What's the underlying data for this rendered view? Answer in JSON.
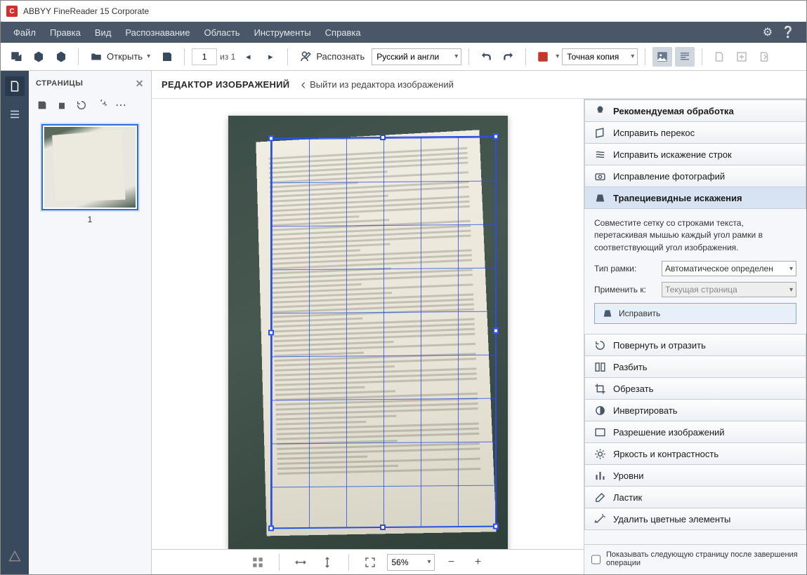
{
  "titlebar": {
    "title": "ABBYY FineReader 15 Corporate"
  },
  "menubar": {
    "items": [
      "Файл",
      "Правка",
      "Вид",
      "Распознавание",
      "Область",
      "Инструменты",
      "Справка"
    ]
  },
  "toolbar": {
    "open_label": "Открыть",
    "page_current": "1",
    "page_total_label": "из 1",
    "recognize_label": "Распознать",
    "lang_label": "Русский и англи",
    "mode_label": "Точная копия"
  },
  "pagespanel": {
    "title": "СТРАНИЦЫ",
    "thumb_label": "1"
  },
  "editorhdr": {
    "title": "РЕДАКТОР ИЗОБРАЖЕНИЙ",
    "back_label": "Выйти из редактора изображений"
  },
  "bottombar": {
    "zoom": "56%"
  },
  "rightpanel": {
    "tools": {
      "recommended": "Рекомендуемая обработка",
      "deskew": "Исправить перекос",
      "lines": "Исправить искажение строк",
      "photo": "Исправление фотографий",
      "trapezoid": "Трапециевидные искажения",
      "rotate": "Повернуть и отразить",
      "split": "Разбить",
      "crop": "Обрезать",
      "invert": "Инвертировать",
      "resolution": "Разрешение изображений",
      "brightness": "Яркость и контрастность",
      "levels": "Уровни",
      "eraser": "Ластик",
      "remove_color": "Удалить цветные элементы"
    },
    "trapezoid_pane": {
      "help": "Совместите сетку со строками текста, перетаскивая мышью каждый угол рамки в соответствующий угол изображения.",
      "frame_type_label": "Тип рамки:",
      "frame_type_value": "Автоматическое определен",
      "apply_to_label": "Применить к:",
      "apply_to_value": "Текущая страница",
      "action_label": "Исправить"
    },
    "footer": {
      "checkbox_label": "Показывать следующую страницу после завершения операции"
    }
  }
}
